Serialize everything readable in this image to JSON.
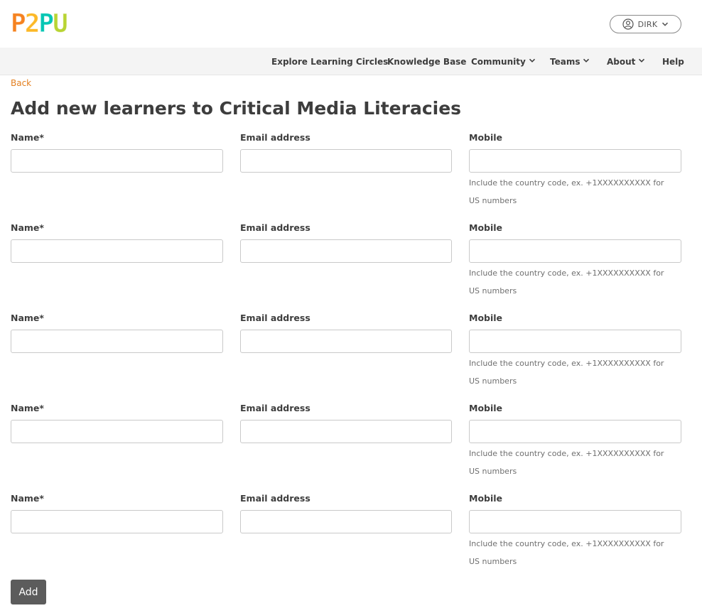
{
  "header": {
    "logo_letters": [
      "P",
      "2",
      "P",
      "U"
    ],
    "logo_colors": [
      "#f58220",
      "#fcb827",
      "#05c6b4",
      "#b8d433"
    ],
    "user_label": "DIRK"
  },
  "nav": {
    "items": [
      {
        "label": "Explore Learning Circles",
        "dropdown": false
      },
      {
        "label": "Knowledge Base",
        "dropdown": false
      },
      {
        "label": "Community",
        "dropdown": true
      },
      {
        "label": "Teams",
        "dropdown": true
      },
      {
        "label": "About",
        "dropdown": true
      },
      {
        "label": "Help",
        "dropdown": false
      }
    ]
  },
  "main": {
    "back_label": "Back",
    "title": "Add new learners to Critical Media Literacies",
    "rows": [
      {
        "name_label": "Name*",
        "email_label": "Email address",
        "mobile_label": "Mobile",
        "mobile_hint": "Include the country code, ex. +1XXXXXXXXXX for US numbers",
        "name_value": "",
        "email_value": "",
        "mobile_value": ""
      },
      {
        "name_label": "Name*",
        "email_label": "Email address",
        "mobile_label": "Mobile",
        "mobile_hint": "Include the country code, ex. +1XXXXXXXXXX for US numbers",
        "name_value": "",
        "email_value": "",
        "mobile_value": ""
      },
      {
        "name_label": "Name*",
        "email_label": "Email address",
        "mobile_label": "Mobile",
        "mobile_hint": "Include the country code, ex. +1XXXXXXXXXX for US numbers",
        "name_value": "",
        "email_value": "",
        "mobile_value": ""
      },
      {
        "name_label": "Name*",
        "email_label": "Email address",
        "mobile_label": "Mobile",
        "mobile_hint": "Include the country code, ex. +1XXXXXXXXXX for US numbers",
        "name_value": "",
        "email_value": "",
        "mobile_value": ""
      },
      {
        "name_label": "Name*",
        "email_label": "Email address",
        "mobile_label": "Mobile",
        "mobile_hint": "Include the country code, ex. +1XXXXXXXXXX for US numbers",
        "name_value": "",
        "email_value": "",
        "mobile_value": ""
      }
    ],
    "add_label": "Add"
  },
  "colors": {
    "accent": "#e37f1f",
    "button_bg": "#5c5c5c"
  }
}
